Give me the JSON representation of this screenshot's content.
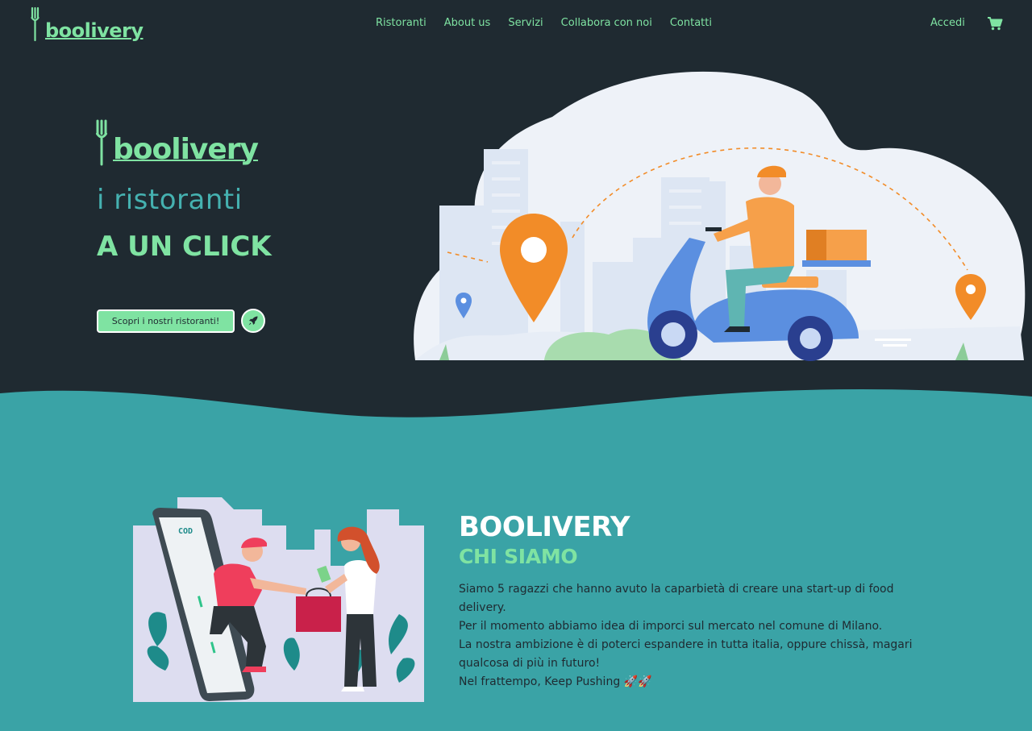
{
  "brand": {
    "name": "boolivery"
  },
  "nav": {
    "links": [
      "Ristoranti",
      "About us",
      "Servizi",
      "Collabora con noi",
      "Contatti"
    ],
    "login": "Accedi",
    "cart_icon": "cart-icon"
  },
  "hero": {
    "tagline_1": "i ristoranti",
    "tagline_2": "A UN CLICK",
    "cta_label": "Scopri i nostri ristoranti!",
    "cta_icon": "rocket-icon"
  },
  "about": {
    "title": "BOOLIVERY",
    "subtitle": "CHI SIAMO",
    "paragraphs": [
      "Siamo 5 ragazzi che hanno avuto la caparbietà di creare una start-up di food delivery.",
      "Per il momento abbiamo idea di imporci sul mercato nel comune di Milano.",
      "La nostra ambizione è di poterci espandere in tutta italia, oppure chissà, magari qualcosa di più in futuro!",
      "Nel frattempo, Keep Pushing 🚀🚀"
    ],
    "illustration_label": "COD"
  },
  "colors": {
    "dark": "#1f2a31",
    "mint": "#7fe3a2",
    "teal": "#3aa3a6",
    "teal_light": "#45b1b0",
    "orange": "#f28c28"
  }
}
